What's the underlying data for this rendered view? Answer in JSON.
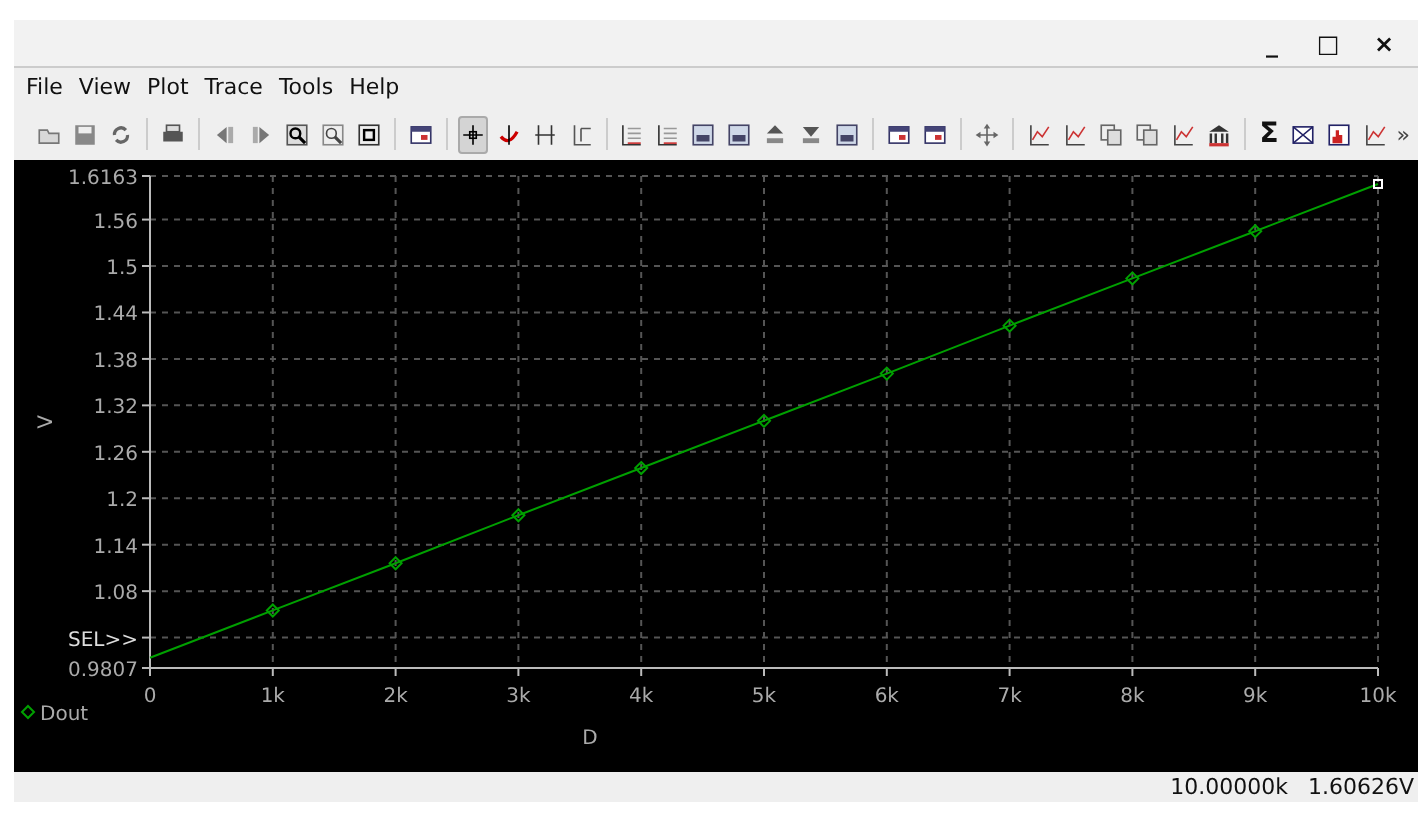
{
  "window": {
    "controls": [
      "_",
      "□",
      "×"
    ]
  },
  "menu": [
    {
      "label": "File"
    },
    {
      "label": "View"
    },
    {
      "label": "Plot"
    },
    {
      "label": "Trace"
    },
    {
      "label": "Tools"
    },
    {
      "label": "Help"
    }
  ],
  "toolbar": {
    "groups": [
      [
        {
          "kind": "open",
          "selected": false
        },
        {
          "kind": "save",
          "selected": false
        },
        {
          "kind": "reload",
          "selected": false
        }
      ],
      [
        {
          "kind": "print",
          "selected": false
        }
      ],
      [
        {
          "kind": "back",
          "selected": false
        },
        {
          "kind": "forward",
          "selected": false
        },
        {
          "kind": "zoomin",
          "selected": false
        },
        {
          "kind": "zoomout",
          "selected": false
        },
        {
          "kind": "zoomfit",
          "selected": false
        }
      ],
      [
        {
          "kind": "window",
          "selected": false
        }
      ],
      [
        {
          "kind": "crosshair",
          "selected": true
        },
        {
          "kind": "cursor",
          "selected": false
        },
        {
          "kind": "hcursor",
          "selected": false
        },
        {
          "kind": "xycursor",
          "selected": false
        }
      ],
      [
        {
          "kind": "grid",
          "selected": false
        },
        {
          "kind": "grid",
          "selected": false
        },
        {
          "kind": "panel",
          "selected": false
        },
        {
          "kind": "panel",
          "selected": false
        },
        {
          "kind": "up",
          "selected": false
        },
        {
          "kind": "down",
          "selected": false
        },
        {
          "kind": "panel",
          "selected": false
        }
      ],
      [
        {
          "kind": "window",
          "selected": false
        },
        {
          "kind": "window",
          "selected": false
        }
      ],
      [
        {
          "kind": "move",
          "selected": false
        }
      ],
      [
        {
          "kind": "chart",
          "selected": false
        },
        {
          "kind": "chart",
          "selected": false
        },
        {
          "kind": "copy",
          "selected": false
        },
        {
          "kind": "copy",
          "selected": false
        },
        {
          "kind": "chart",
          "selected": false
        },
        {
          "kind": "bank",
          "selected": false
        }
      ],
      [
        {
          "kind": "sigma",
          "selected": false,
          "glyph": "Σ"
        },
        {
          "kind": "envelope",
          "selected": false
        },
        {
          "kind": "histogram",
          "selected": false
        },
        {
          "kind": "chart",
          "selected": false
        }
      ]
    ],
    "overflow": "»"
  },
  "plot": {
    "chart_data": {
      "type": "line",
      "grid": true,
      "xlabel": "D",
      "ylabel": "V",
      "x": [
        0,
        1000,
        2000,
        3000,
        4000,
        5000,
        6000,
        7000,
        8000,
        9000,
        10000
      ],
      "series": [
        {
          "name": "Dout",
          "color": "#00a000",
          "marker": "diamond",
          "values": [
            0.994,
            1.055,
            1.116,
            1.178,
            1.239,
            1.3,
            1.361,
            1.423,
            1.484,
            1.545,
            1.606
          ]
        }
      ],
      "xlim": [
        0,
        10000
      ],
      "ylim": [
        0.9807,
        1.6163
      ],
      "xticks": [
        {
          "value": 0,
          "label": "0"
        },
        {
          "value": 1000,
          "label": "1k"
        },
        {
          "value": 2000,
          "label": "2k"
        },
        {
          "value": 3000,
          "label": "3k"
        },
        {
          "value": 4000,
          "label": "4k"
        },
        {
          "value": 5000,
          "label": "5k"
        },
        {
          "value": 6000,
          "label": "6k"
        },
        {
          "value": 7000,
          "label": "7k"
        },
        {
          "value": 8000,
          "label": "8k"
        },
        {
          "value": 9000,
          "label": "9k"
        },
        {
          "value": 10000,
          "label": "10k"
        }
      ],
      "yticks": [
        {
          "value": 0.9807,
          "label": "0.9807"
        },
        {
          "value": 1.02,
          "label": "SEL>>"
        },
        {
          "value": 1.08,
          "label": "1.08"
        },
        {
          "value": 1.14,
          "label": "1.14"
        },
        {
          "value": 1.2,
          "label": "1.2"
        },
        {
          "value": 1.26,
          "label": "1.26"
        },
        {
          "value": 1.32,
          "label": "1.32"
        },
        {
          "value": 1.38,
          "label": "1.38"
        },
        {
          "value": 1.44,
          "label": "1.44"
        },
        {
          "value": 1.5,
          "label": "1.5"
        },
        {
          "value": 1.56,
          "label": "1.56"
        },
        {
          "value": 1.6163,
          "label": "1.6163"
        }
      ]
    }
  },
  "status_bar": [
    "10.00000k",
    "1.60626V"
  ]
}
